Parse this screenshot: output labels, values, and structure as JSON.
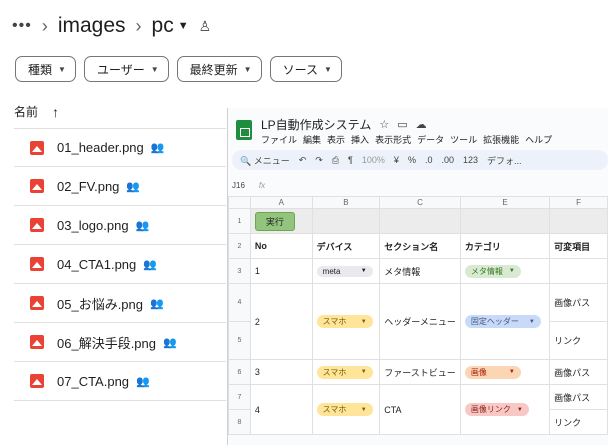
{
  "breadcrumb": {
    "more": "•••",
    "folder1": "images",
    "folder2": "pc"
  },
  "filters": [
    "種類",
    "ユーザー",
    "最終更新",
    "ソース"
  ],
  "list": {
    "column_header": "名前",
    "files": [
      "01_header.png",
      "02_FV.png",
      "03_logo.png",
      "04_CTA1.png",
      "05_お悩み.png",
      "06_解決手段.png",
      "07_CTA.png"
    ]
  },
  "sheet": {
    "title": "LP自動作成システム",
    "menus": [
      "ファイル",
      "編集",
      "表示",
      "挿入",
      "表示形式",
      "データ",
      "ツール",
      "拡張機能",
      "ヘルプ"
    ],
    "toolbar": {
      "search": "メニュー",
      "zoom": "100%",
      "currency": "¥",
      "percent": "%",
      "dec_less": ".0",
      "dec_more": ".00",
      "number": "123",
      "font": "デフォ..."
    },
    "cell_ref": "J16",
    "fx": "fx",
    "columns": [
      "A",
      "B",
      "C",
      "E",
      "F"
    ],
    "row_numbers": [
      "1",
      "2",
      "3",
      "4",
      "5",
      "6",
      "7",
      "8"
    ],
    "run_button": "実行",
    "headers": {
      "no": "No",
      "device": "デバイス",
      "section": "セクション名",
      "category": "カテゴリ",
      "variable": "可変項目"
    },
    "rows": [
      {
        "no": "1",
        "device": "meta",
        "section": "メタ情報",
        "category": "メタ情報",
        "var1": "",
        "var2": ""
      },
      {
        "no": "2",
        "device": "スマホ",
        "section": "ヘッダーメニュー",
        "category": "固定ヘッダー",
        "var1": "画像パス",
        "var2": "リンク"
      },
      {
        "no": "3",
        "device": "スマホ",
        "section": "ファーストビュー",
        "category": "画像",
        "var1": "画像パス",
        "var2": ""
      },
      {
        "no": "4",
        "device": "スマホ",
        "section": "CTA",
        "category": "画像リンク",
        "var1": "画像パス",
        "var2": "リンク"
      }
    ]
  }
}
